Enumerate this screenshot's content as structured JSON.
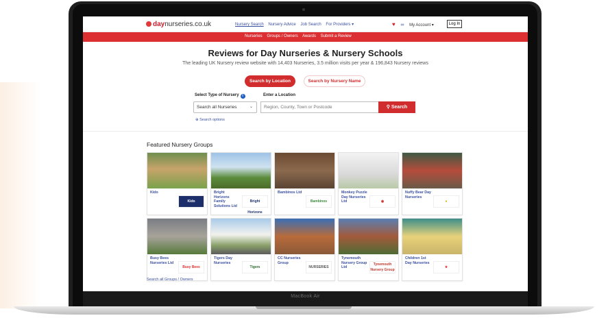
{
  "device": {
    "label": "MacBook Air"
  },
  "nav": {
    "logo_brand": "day",
    "logo_rest": "nurseries.co.uk",
    "links": [
      "Nursery Search",
      "Nursery Advice",
      "Job Search",
      "For Providers ▾"
    ],
    "my_account": "My Account ▾",
    "login": "Log In"
  },
  "subnav": {
    "links": [
      "Nurseries",
      "Groups / Owners",
      "Awards",
      "Submit a Review"
    ]
  },
  "hero": {
    "title": "Reviews for Day Nurseries & Nursery Schools",
    "subtitle": "The leading UK Nursery review website with 14,403 Nurseries, 3.5 million visits per year & 196,843 Nursery reviews"
  },
  "search": {
    "by_location": "Search by Location",
    "by_name": "Search by Nursery Name",
    "type_label": "Select Type of Nursery",
    "type_value": "Search all Nurseries",
    "location_label": "Enter a Location",
    "location_placeholder": "Region, County, Town or Postcode",
    "button": "Search",
    "options": "Search options"
  },
  "featured": {
    "title": "Featured Nursery Groups",
    "see_all": "Search all Groups / Owners",
    "groups": [
      {
        "name": "Kido",
        "logo_text": "Kido"
      },
      {
        "name": "Bright Horizons Family Solutions Ltd",
        "logo_text": "Bright Horizons"
      },
      {
        "name": "Bambinos Ltd",
        "logo_text": "Bambinos"
      },
      {
        "name": "Monkey Puzzle Day Nurseries Ltd",
        "logo_text": ""
      },
      {
        "name": "Nuffy Bear Day Nurseries",
        "logo_text": ""
      },
      {
        "name": "Busy Bees Nurseries Ltd",
        "logo_text": "Busy Bees"
      },
      {
        "name": "Tigers Day Nurseries",
        "logo_text": "Tigers"
      },
      {
        "name": "CC Nurseries Group",
        "logo_text": "NURSERIES"
      },
      {
        "name": "Tynemouth Nursery Group Ltd",
        "logo_text": "Tynemouth Nursery Group"
      },
      {
        "name": "Children 1st Day Nurseries",
        "logo_text": ""
      }
    ]
  },
  "colors": {
    "brand_red": "#dc2f32",
    "link_blue": "#3a4fa0"
  }
}
